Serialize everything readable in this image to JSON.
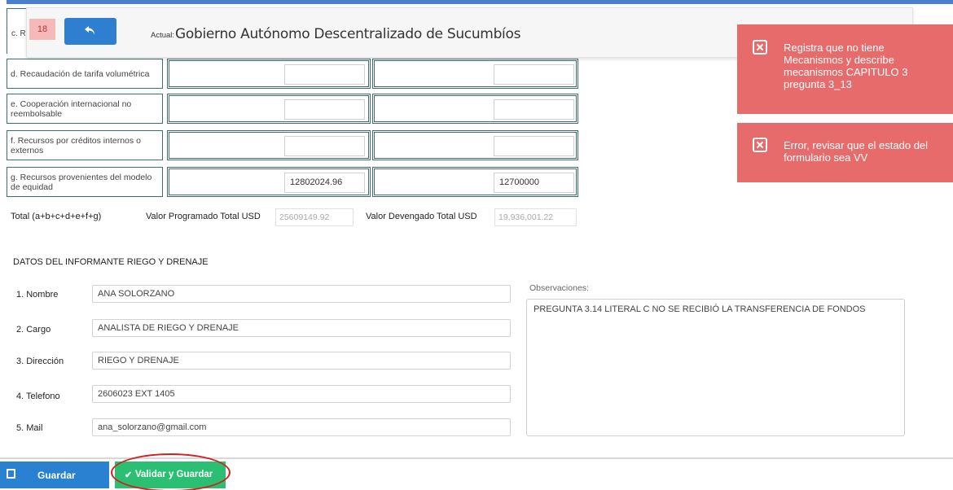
{
  "header": {
    "peek_label": "c. R",
    "badge": "18",
    "actual_label": "Actual:",
    "actual_name": "Gobierno Autónomo Descentralizado de Sucumbíos"
  },
  "funding_rows": [
    {
      "label": "d. Recaudación de tarifa volumétrica",
      "programado": "",
      "devengado": ""
    },
    {
      "label": "e. Cooperación internacional no reembolsable",
      "programado": "",
      "devengado": ""
    },
    {
      "label": "f. Recursos por créditos internos o externos",
      "programado": "",
      "devengado": ""
    },
    {
      "label": "g. Recursos provenientes del modelo de equidad",
      "programado": "12802024.96",
      "devengado": "12700000"
    }
  ],
  "totals": {
    "label": "Total (a+b+c+d+e+f+g)",
    "programado_label": "Valor Programado Total USD",
    "programado_value": "25609149.92",
    "devengado_label": "Valor Devengado Total USD",
    "devengado_value": "19,936,001.22"
  },
  "informante": {
    "section_title": "DATOS DEL INFORMANTE RIEGO Y DRENAJE",
    "fields": [
      {
        "label": "1. Nombre",
        "value": "ANA SOLORZANO"
      },
      {
        "label": "2. Cargo",
        "value": "ANALISTA DE RIEGO Y DRENAJE"
      },
      {
        "label": "3. Dirección",
        "value": "RIEGO Y DRENAJE"
      },
      {
        "label": "4. Telefono",
        "value": "2606023 EXT 1405"
      },
      {
        "label": "5. Mail",
        "value": "ana_solorzano@gmail.com"
      }
    ],
    "observaciones_label": "Observaciones:",
    "observaciones_value": "PREGUNTA 3.14 LITERAL C NO SE RECIBIÓ LA TRANSFERENCIA DE FONDOS"
  },
  "toasts": [
    {
      "message": "Registra que no tiene Mecanismos y describe mecanismos CAPITULO 3 pregunta 3_13"
    },
    {
      "message": "Error, revisar que el estado del formulario sea VV"
    }
  ],
  "actions": {
    "guardar_label": "Guardar",
    "validar_label": "Validar y Guardar"
  },
  "colors": {
    "primary": "#2a81d2",
    "success": "#2bbf73",
    "error_toast": "#e86b6b",
    "highlight": "#d61e1e"
  }
}
